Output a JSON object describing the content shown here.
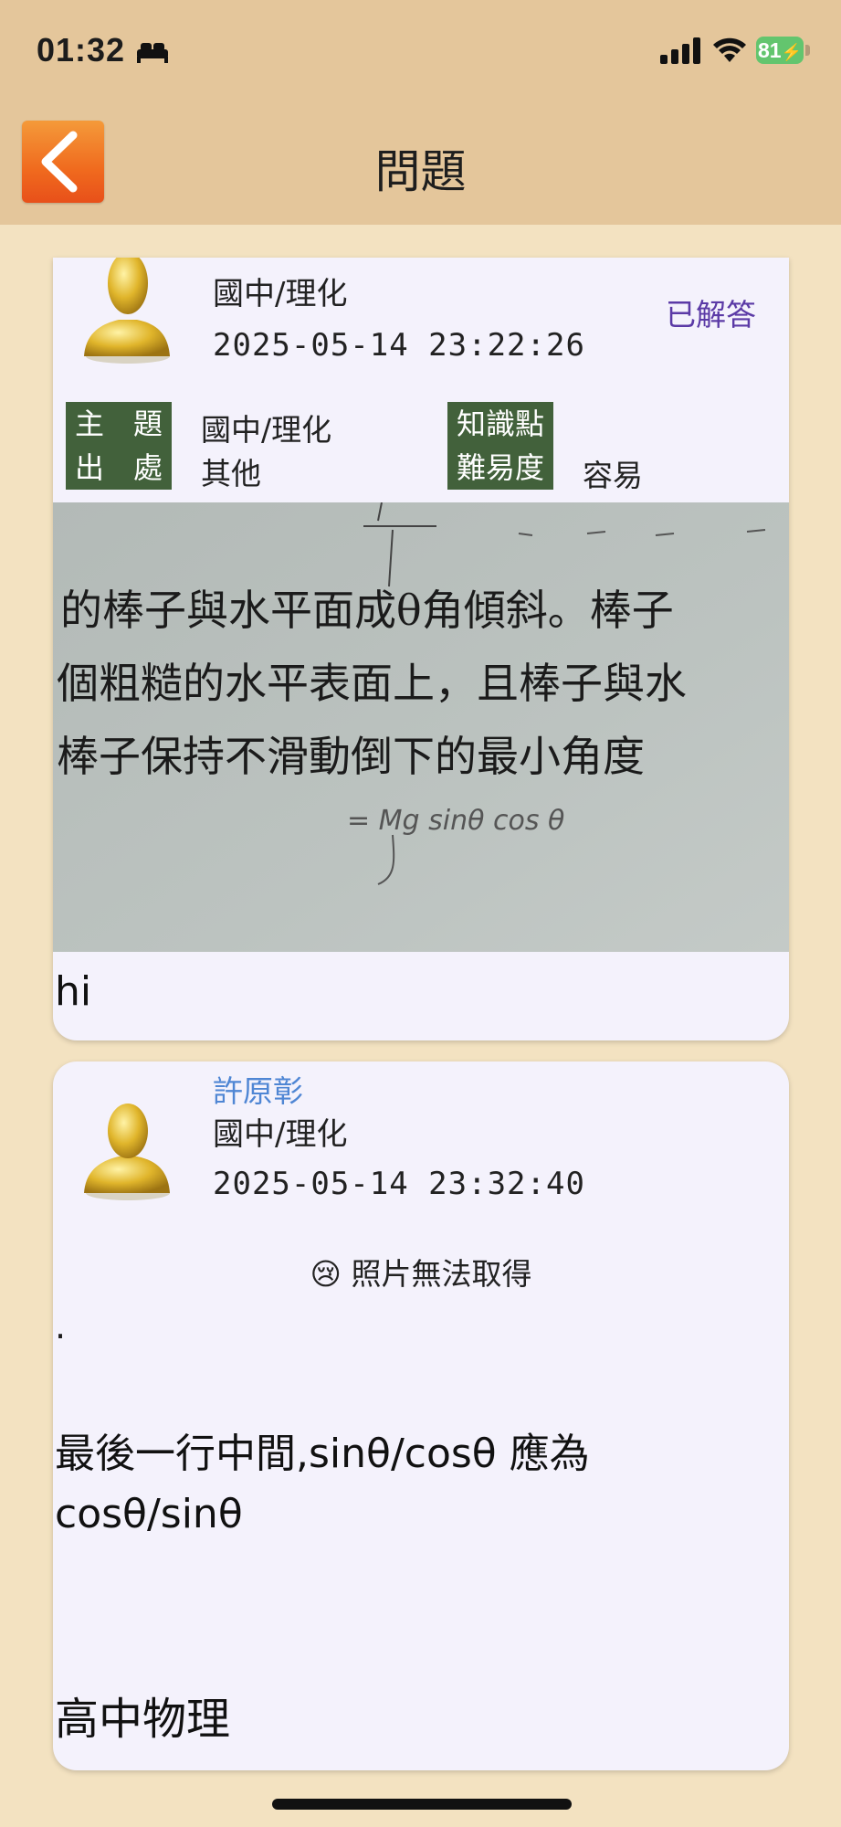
{
  "status_bar": {
    "time": "01:32",
    "battery": "81",
    "icons": [
      "sleep-icon",
      "signal-icon",
      "wifi-icon",
      "battery-icon"
    ]
  },
  "header": {
    "title": "問題",
    "back_icon": "chevron-left-icon"
  },
  "question": {
    "subject": "國中/理化",
    "datetime": "2025-05-14 23:22:26",
    "status": "已解答",
    "tags": {
      "topic_label": "主　題",
      "topic_value": "國中/理化",
      "source_label": "出　處",
      "source_value": "其他",
      "knowledge_label": "知識點",
      "knowledge_value": "",
      "difficulty_label": "難易度",
      "difficulty_value": "容易"
    },
    "photo_lines": [
      "的棒子與水平面成θ角傾斜。棒子",
      "個粗糙的水平表面上，且棒子與水",
      "棒子保持不滑動倒下的最小角度"
    ],
    "photo_handwriting": "= Mg sinθ cos θ",
    "text": "hi"
  },
  "answer": {
    "user": "許原彰",
    "subject": "國中/理化",
    "datetime": "2025-05-14 23:32:40",
    "photo_missing": "😢  照片無法取得",
    "dot": ".",
    "text": "最後一行中間,sinθ/cosθ 應為 cosθ/sinθ",
    "text2": "高中物理"
  }
}
